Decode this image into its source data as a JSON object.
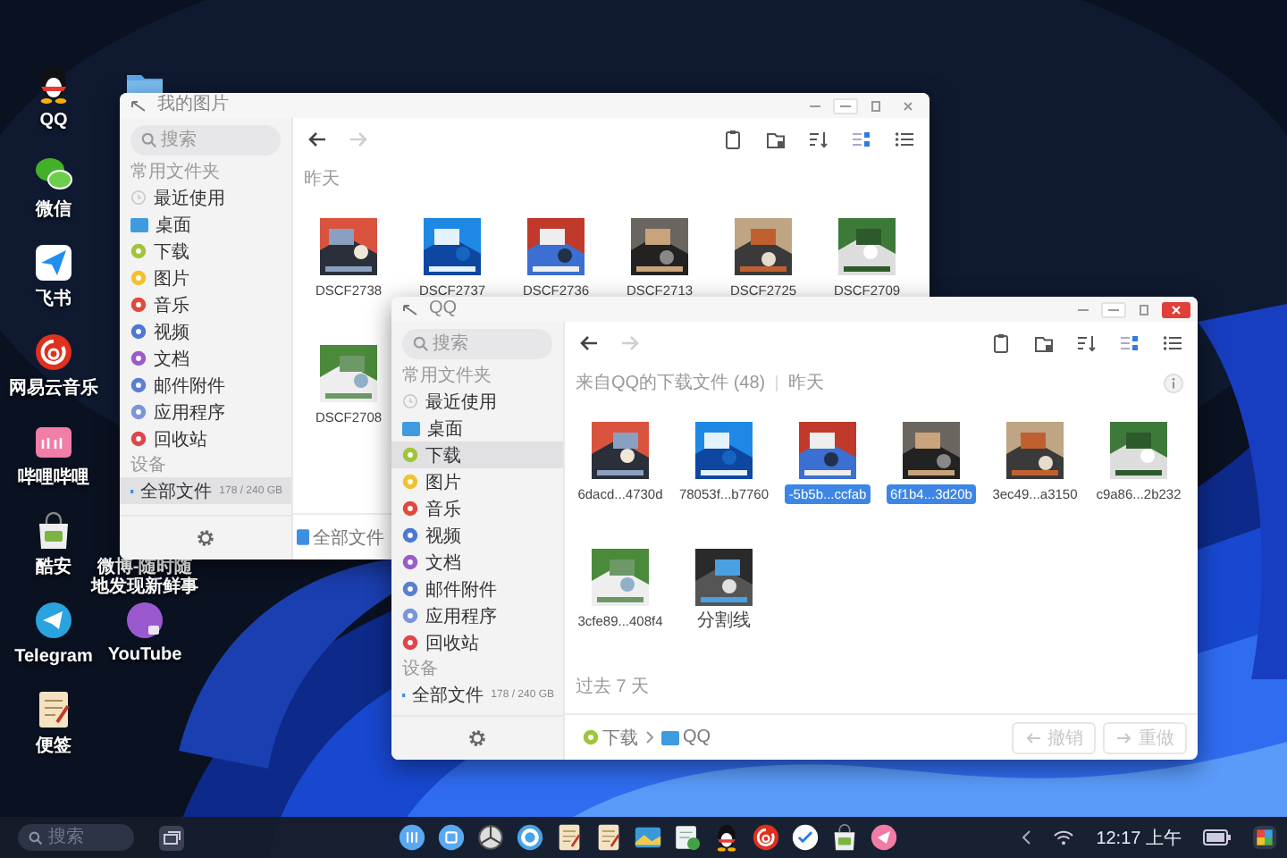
{
  "desktop_icons": [
    {
      "label": "QQ",
      "kind": "qq"
    },
    {
      "label": "微信",
      "kind": "wechat"
    },
    {
      "label": "飞书",
      "kind": "feishu"
    },
    {
      "label": "网易云音乐",
      "kind": "music"
    },
    {
      "label": "哔哩哔哩",
      "kind": "bili"
    },
    {
      "label": "酷安",
      "kind": "store"
    },
    {
      "label": "Telegram",
      "kind": "telegram"
    },
    {
      "label": "便签",
      "kind": "notes"
    }
  ],
  "desktop_icons_2": [
    {
      "kind": "folder"
    },
    {
      "label": "微博-随时随地发现新鲜事",
      "kind": "weibo"
    },
    {
      "label": "YouTube",
      "kind": "youtube"
    }
  ],
  "windows": [
    {
      "title": "我的图片",
      "focused": false,
      "search": {
        "placeholder": "搜索"
      },
      "sections": [
        {
          "heading": "常用文件夹",
          "items": [
            {
              "label": "最近使用",
              "kind": "recent",
              "selected": false
            },
            {
              "label": "桌面",
              "kind": "desktop",
              "selected": false
            },
            {
              "label": "下载",
              "kind": "dot",
              "color": "#a0c53a",
              "selected": false
            },
            {
              "label": "图片",
              "kind": "dot",
              "color": "#f2c12e",
              "selected": false
            },
            {
              "label": "音乐",
              "kind": "dot",
              "color": "#e04a3c",
              "selected": false
            },
            {
              "label": "视频",
              "kind": "dot",
              "color": "#4c78d6",
              "selected": false
            },
            {
              "label": "文档",
              "kind": "dot",
              "color": "#9a5cc8",
              "selected": false
            },
            {
              "label": "邮件附件",
              "kind": "dot",
              "color": "#5a7ed0",
              "selected": false
            },
            {
              "label": "应用程序",
              "kind": "dot",
              "color": "#7a96d8",
              "selected": false
            },
            {
              "label": "回收站",
              "kind": "dot",
              "color": "#e0454a",
              "selected": false
            }
          ]
        },
        {
          "heading": "设备",
          "items": [
            {
              "label": "全部文件",
              "kind": "drive",
              "detail": "178 / 240 GB",
              "selected": true
            }
          ]
        }
      ],
      "nav": {
        "back_enabled": true,
        "forward_enabled": false
      },
      "grid_view": true,
      "groups": [
        {
          "heading": "昨天",
          "files": [
            {
              "name": "DSCF2738",
              "selected": false
            },
            {
              "name": "DSCF2737",
              "selected": false
            },
            {
              "name": "DSCF2736",
              "selected": false
            },
            {
              "name": "DSCF2713",
              "selected": false
            },
            {
              "name": "DSCF2725",
              "selected": false
            },
            {
              "name": "DSCF2709",
              "selected": false
            },
            {
              "name": "DSCF2708",
              "selected": false
            }
          ]
        }
      ],
      "breadcrumb": [
        {
          "label": "全部文件",
          "kind": "drive"
        }
      ]
    },
    {
      "title": "QQ",
      "focused": true,
      "search": {
        "placeholder": "搜索"
      },
      "sections": [
        {
          "heading": "常用文件夹",
          "items": [
            {
              "label": "最近使用",
              "kind": "recent",
              "selected": false
            },
            {
              "label": "桌面",
              "kind": "desktop",
              "selected": false
            },
            {
              "label": "下载",
              "kind": "dot",
              "color": "#a0c53a",
              "selected": true
            },
            {
              "label": "图片",
              "kind": "dot",
              "color": "#f2c12e",
              "selected": false
            },
            {
              "label": "音乐",
              "kind": "dot",
              "color": "#e04a3c",
              "selected": false
            },
            {
              "label": "视频",
              "kind": "dot",
              "color": "#4c78d6",
              "selected": false
            },
            {
              "label": "文档",
              "kind": "dot",
              "color": "#9a5cc8",
              "selected": false
            },
            {
              "label": "邮件附件",
              "kind": "dot",
              "color": "#5a7ed0",
              "selected": false
            },
            {
              "label": "应用程序",
              "kind": "dot",
              "color": "#7a96d8",
              "selected": false
            },
            {
              "label": "回收站",
              "kind": "dot",
              "color": "#e0454a",
              "selected": false
            }
          ]
        },
        {
          "heading": "设备",
          "items": [
            {
              "label": "全部文件",
              "kind": "drive",
              "detail": "178 / 240 GB",
              "selected": false
            }
          ]
        }
      ],
      "nav": {
        "back_enabled": true,
        "forward_enabled": false
      },
      "grid_view": true,
      "location": "来自QQ的下载文件 (48)",
      "groups": [
        {
          "heading": "昨天",
          "files": [
            {
              "name": "6dacd...4730d",
              "selected": false
            },
            {
              "name": "78053f...b7760",
              "selected": false
            },
            {
              "name": "-5b5b...ccfab",
              "selected": true
            },
            {
              "name": "6f1b4...3d20b",
              "selected": true
            },
            {
              "name": "3ec49...a3150",
              "selected": false
            },
            {
              "name": "c9a86...2b232",
              "selected": false
            },
            {
              "name": "3cfe89...408f4",
              "selected": false
            },
            {
              "name": "分割线",
              "selected": false
            }
          ]
        },
        {
          "heading": "过去 7 天"
        }
      ],
      "breadcrumb": [
        {
          "label": "下载",
          "kind": "download"
        },
        {
          "label": "QQ",
          "kind": "folder"
        }
      ],
      "actions": [
        {
          "label": "撤销",
          "kind": "undo",
          "disabled": true
        },
        {
          "label": "重做",
          "kind": "redo",
          "disabled": true
        }
      ]
    }
  ],
  "taskbar": {
    "search": {
      "placeholder": "搜索"
    },
    "dock": [
      {
        "kind": "launcher"
      },
      {
        "kind": "home"
      },
      {
        "kind": "wheel"
      },
      {
        "kind": "browser"
      },
      {
        "kind": "notes"
      },
      {
        "kind": "notes"
      },
      {
        "kind": "gallery"
      },
      {
        "kind": "files"
      },
      {
        "kind": "qq"
      },
      {
        "kind": "music"
      },
      {
        "kind": "todo"
      },
      {
        "kind": "store"
      },
      {
        "kind": "feishupink"
      }
    ],
    "clock": "12:17 上午"
  }
}
